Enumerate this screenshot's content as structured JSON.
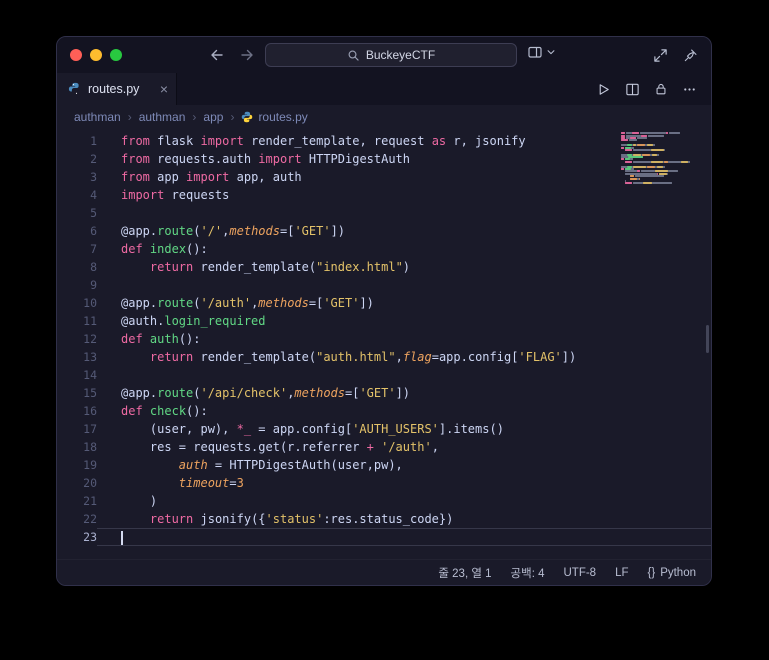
{
  "theme": {
    "bgEditor": "#1a1a29",
    "bgChrome": "#131321",
    "kw": "#ee6aa3",
    "fn": "#61d885",
    "str": "#e3c269",
    "pr": "#eda35f",
    "nu": "#eda35f",
    "tx": "#cdd6f4",
    "gutter": "#555a77",
    "gutterActive": "#aab1cf",
    "crumb": "#7e8ab8"
  },
  "titlebar": {
    "search_value": "BuckeyeCTF"
  },
  "tabs": [
    {
      "label": "routes.py",
      "close_glyph": "×"
    }
  ],
  "breadcrumb": [
    "authman",
    "authman",
    "app",
    "routes.py"
  ],
  "editor": {
    "cursor_line": 23,
    "lines": [
      {
        "n": 1,
        "t": [
          [
            "kw",
            "from"
          ],
          [
            "tx",
            " flask "
          ],
          [
            "kw",
            "import"
          ],
          [
            "tx",
            " render_template, request "
          ],
          [
            "kw",
            "as"
          ],
          [
            "tx",
            " r, jsonify"
          ]
        ]
      },
      {
        "n": 2,
        "t": [
          [
            "kw",
            "from"
          ],
          [
            "tx",
            " requests.auth "
          ],
          [
            "kw",
            "import"
          ],
          [
            "tx",
            " HTTPDigestAuth"
          ]
        ]
      },
      {
        "n": 3,
        "t": [
          [
            "kw",
            "from"
          ],
          [
            "tx",
            " app "
          ],
          [
            "kw",
            "import"
          ],
          [
            "tx",
            " app, auth"
          ]
        ]
      },
      {
        "n": 4,
        "t": [
          [
            "kw",
            "import"
          ],
          [
            "tx",
            " requests"
          ]
        ]
      },
      {
        "n": 5,
        "t": []
      },
      {
        "n": 6,
        "t": [
          [
            "tx",
            "@app."
          ],
          [
            "fn",
            "route"
          ],
          [
            "tx",
            "("
          ],
          [
            "str",
            "'/'"
          ],
          [
            "tx",
            ","
          ],
          [
            "pr",
            "methods"
          ],
          [
            "tx",
            "=["
          ],
          [
            "str",
            "'GET'"
          ],
          [
            "tx",
            "])"
          ]
        ]
      },
      {
        "n": 7,
        "t": [
          [
            "kw",
            "def"
          ],
          [
            "tx",
            " "
          ],
          [
            "fn",
            "index"
          ],
          [
            "tx",
            "():"
          ]
        ]
      },
      {
        "n": 8,
        "t": [
          [
            "tx",
            "    "
          ],
          [
            "kw",
            "return"
          ],
          [
            "tx",
            " render_template("
          ],
          [
            "str",
            "\"index.html\""
          ],
          [
            "tx",
            ")"
          ]
        ]
      },
      {
        "n": 9,
        "t": []
      },
      {
        "n": 10,
        "t": [
          [
            "tx",
            "@app."
          ],
          [
            "fn",
            "route"
          ],
          [
            "tx",
            "("
          ],
          [
            "str",
            "'/auth'"
          ],
          [
            "tx",
            ","
          ],
          [
            "pr",
            "methods"
          ],
          [
            "tx",
            "=["
          ],
          [
            "str",
            "'GET'"
          ],
          [
            "tx",
            "])"
          ]
        ]
      },
      {
        "n": 11,
        "t": [
          [
            "tx",
            "@auth."
          ],
          [
            "fn",
            "login_required"
          ]
        ]
      },
      {
        "n": 12,
        "t": [
          [
            "kw",
            "def"
          ],
          [
            "tx",
            " "
          ],
          [
            "fn",
            "auth"
          ],
          [
            "tx",
            "():"
          ]
        ]
      },
      {
        "n": 13,
        "t": [
          [
            "tx",
            "    "
          ],
          [
            "kw",
            "return"
          ],
          [
            "tx",
            " render_template("
          ],
          [
            "str",
            "\"auth.html\""
          ],
          [
            "tx",
            ","
          ],
          [
            "pr",
            "flag"
          ],
          [
            "tx",
            "=app.config["
          ],
          [
            "str",
            "'FLAG'"
          ],
          [
            "tx",
            "])"
          ]
        ]
      },
      {
        "n": 14,
        "t": []
      },
      {
        "n": 15,
        "t": [
          [
            "tx",
            "@app."
          ],
          [
            "fn",
            "route"
          ],
          [
            "tx",
            "("
          ],
          [
            "str",
            "'/api/check'"
          ],
          [
            "tx",
            ","
          ],
          [
            "pr",
            "methods"
          ],
          [
            "tx",
            "=["
          ],
          [
            "str",
            "'GET'"
          ],
          [
            "tx",
            "])"
          ]
        ]
      },
      {
        "n": 16,
        "t": [
          [
            "kw",
            "def"
          ],
          [
            "tx",
            " "
          ],
          [
            "fn",
            "check"
          ],
          [
            "tx",
            "():"
          ]
        ]
      },
      {
        "n": 17,
        "t": [
          [
            "tx",
            "    (user, pw), "
          ],
          [
            "kw",
            "*_"
          ],
          [
            "tx",
            " = app.config["
          ],
          [
            "str",
            "'AUTH_USERS'"
          ],
          [
            "tx",
            "].items()"
          ]
        ]
      },
      {
        "n": 18,
        "t": [
          [
            "tx",
            "    res = requests.get(r.referrer "
          ],
          [
            "kw",
            "+"
          ],
          [
            "tx",
            " "
          ],
          [
            "str",
            "'/auth'"
          ],
          [
            "tx",
            ","
          ]
        ]
      },
      {
        "n": 19,
        "t": [
          [
            "tx",
            "        "
          ],
          [
            "pr",
            "auth"
          ],
          [
            "tx",
            " = HTTPDigestAuth(user,pw),"
          ]
        ]
      },
      {
        "n": 20,
        "t": [
          [
            "tx",
            "        "
          ],
          [
            "pr",
            "timeout"
          ],
          [
            "tx",
            "="
          ],
          [
            "nu",
            "3"
          ]
        ]
      },
      {
        "n": 21,
        "t": [
          [
            "tx",
            "    )"
          ]
        ]
      },
      {
        "n": 22,
        "t": [
          [
            "tx",
            "    "
          ],
          [
            "kw",
            "return"
          ],
          [
            "tx",
            " jsonify({"
          ],
          [
            "str",
            "'status'"
          ],
          [
            "tx",
            ":res.status_code})"
          ]
        ]
      },
      {
        "n": 23,
        "t": []
      }
    ]
  },
  "status": {
    "line_col": "줄 23, 열 1",
    "indent": "공백: 4",
    "encoding": "UTF-8",
    "eol": "LF",
    "lang_icon": "{}",
    "lang": "Python"
  }
}
